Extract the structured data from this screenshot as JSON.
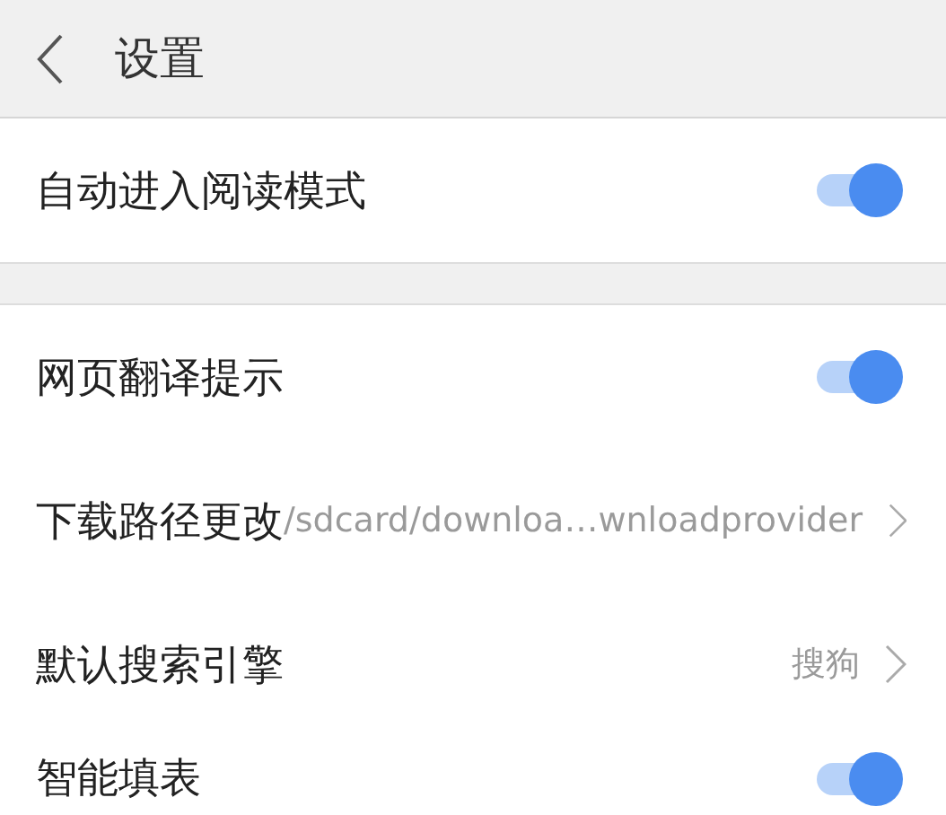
{
  "header": {
    "title": "设置"
  },
  "sections": [
    {
      "rows": [
        {
          "kind": "toggle",
          "label": "自动进入阅读模式",
          "on": true
        }
      ]
    },
    {
      "rows": [
        {
          "kind": "toggle",
          "label": "网页翻译提示",
          "on": true
        },
        {
          "kind": "link",
          "label": "下载路径更改",
          "value": "/sdcard/downloa…wnloadprovider"
        },
        {
          "kind": "link",
          "label": "默认搜索引擎",
          "value": "搜狗"
        },
        {
          "kind": "toggle",
          "label": "智能填表",
          "on": true
        }
      ]
    }
  ]
}
